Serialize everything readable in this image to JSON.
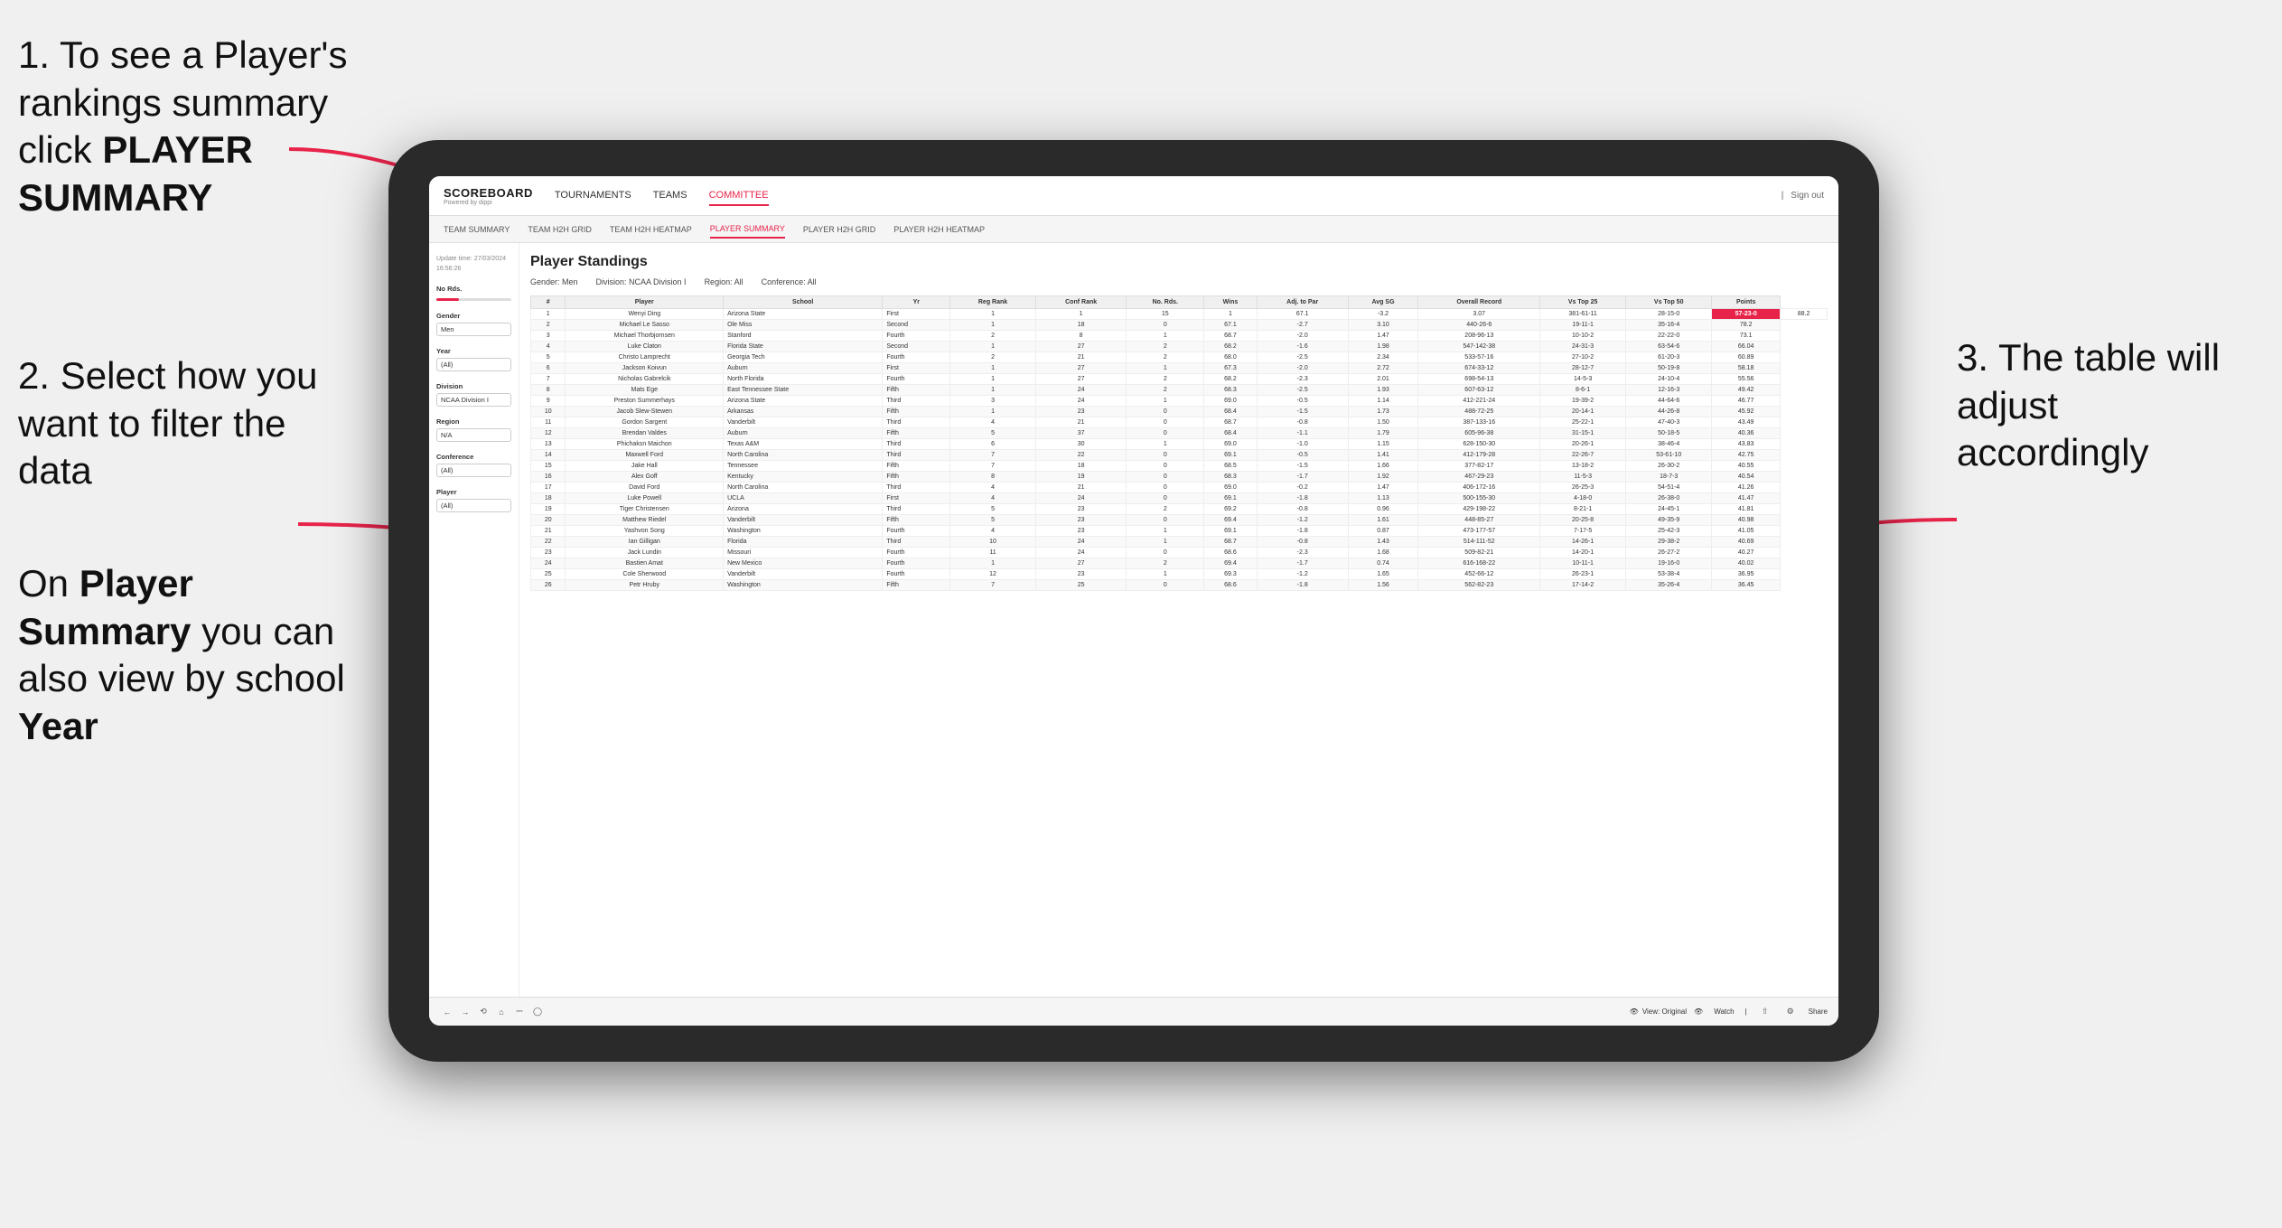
{
  "instructions": {
    "step1": "1. To see a Player's rankings summary click ",
    "step1_bold": "PLAYER SUMMARY",
    "step2_title": "2. Select how you want to filter the data",
    "step3": "3. The table will adjust accordingly",
    "bottom_note_pre": "On ",
    "bottom_bold1": "Player Summary",
    "bottom_note_mid": " you can also view by school ",
    "bottom_bold2": "Year"
  },
  "nav": {
    "logo": "SCOREBOARD",
    "logo_sub": "Powered by dippi",
    "links": [
      "TOURNAMENTS",
      "TEAMS",
      "COMMITTEE"
    ],
    "active_link": "COMMITTEE",
    "sign_out": "Sign out"
  },
  "sub_nav": {
    "links": [
      "TEAM SUMMARY",
      "TEAM H2H GRID",
      "TEAM H2H HEATMAP",
      "PLAYER SUMMARY",
      "PLAYER H2H GRID",
      "PLAYER H2H HEATMAP"
    ],
    "active": "PLAYER SUMMARY"
  },
  "sidebar": {
    "update_label": "Update time:",
    "update_value": "27/03/2024 16:56:26",
    "no_rds_label": "No Rds.",
    "gender_label": "Gender",
    "gender_value": "Men",
    "year_label": "Year",
    "year_value": "(All)",
    "division_label": "Division",
    "division_value": "NCAA Division I",
    "region_label": "Region",
    "region_value": "N/A",
    "conference_label": "Conference",
    "conference_value": "(All)",
    "player_label": "Player",
    "player_value": "(All)"
  },
  "table": {
    "title": "Player Standings",
    "filters": {
      "gender": "Gender: Men",
      "division": "Division: NCAA Division I",
      "region": "Region: All",
      "conference": "Conference: All"
    },
    "columns": [
      "#",
      "Player",
      "School",
      "Yr",
      "Reg Rank",
      "Conf Rank",
      "No. Rds.",
      "Wins",
      "Adj. to Par",
      "Avg SG",
      "Overall Record",
      "Vs Top 25",
      "Vs Top 50",
      "Points"
    ],
    "rows": [
      [
        "1",
        "Wenyi Ding",
        "Arizona State",
        "First",
        "1",
        "1",
        "15",
        "1",
        "67.1",
        "-3.2",
        "3.07",
        "381-61-11",
        "28-15-0",
        "57-23-0",
        "88.2"
      ],
      [
        "2",
        "Michael Le Sasso",
        "Ole Miss",
        "Second",
        "1",
        "18",
        "0",
        "67.1",
        "-2.7",
        "3.10",
        "440-26-6",
        "19-11-1",
        "35-16-4",
        "78.2"
      ],
      [
        "3",
        "Michael Thorbjornsen",
        "Stanford",
        "Fourth",
        "2",
        "8",
        "1",
        "68.7",
        "-2.0",
        "1.47",
        "208-96-13",
        "10-10-2",
        "22-22-0",
        "73.1"
      ],
      [
        "4",
        "Luke Claton",
        "Florida State",
        "Second",
        "1",
        "27",
        "2",
        "68.2",
        "-1.6",
        "1.98",
        "547-142-38",
        "24-31-3",
        "63-54-6",
        "66.04"
      ],
      [
        "5",
        "Christo Lamprecht",
        "Georgia Tech",
        "Fourth",
        "2",
        "21",
        "2",
        "68.0",
        "-2.5",
        "2.34",
        "533-57-16",
        "27-10-2",
        "61-20-3",
        "60.89"
      ],
      [
        "6",
        "Jackson Koivun",
        "Auburn",
        "First",
        "1",
        "27",
        "1",
        "67.3",
        "-2.0",
        "2.72",
        "674-33-12",
        "28-12-7",
        "50-19-8",
        "58.18"
      ],
      [
        "7",
        "Nicholas Gabrelcik",
        "North Florida",
        "Fourth",
        "1",
        "27",
        "2",
        "68.2",
        "-2.3",
        "2.01",
        "698-54-13",
        "14-5-3",
        "24-10-4",
        "55.56"
      ],
      [
        "8",
        "Mats Ege",
        "East Tennessee State",
        "Fifth",
        "1",
        "24",
        "2",
        "68.3",
        "-2.5",
        "1.93",
        "607-63-12",
        "8-6-1",
        "12-16-3",
        "49.42"
      ],
      [
        "9",
        "Preston Summerhays",
        "Arizona State",
        "Third",
        "3",
        "24",
        "1",
        "69.0",
        "-0.5",
        "1.14",
        "412-221-24",
        "19-39-2",
        "44-64-6",
        "46.77"
      ],
      [
        "10",
        "Jacob Slew-Stewen",
        "Arkansas",
        "Fifth",
        "1",
        "23",
        "0",
        "68.4",
        "-1.5",
        "1.73",
        "488-72-25",
        "20-14-1",
        "44-26-8",
        "45.92"
      ],
      [
        "11",
        "Gordon Sargent",
        "Vanderbilt",
        "Third",
        "4",
        "21",
        "0",
        "68.7",
        "-0.8",
        "1.50",
        "387-133-16",
        "25-22-1",
        "47-40-3",
        "43.49"
      ],
      [
        "12",
        "Brendan Valdes",
        "Auburn",
        "Fifth",
        "5",
        "37",
        "0",
        "68.4",
        "-1.1",
        "1.79",
        "605-96-38",
        "31-15-1",
        "50-18-5",
        "40.36"
      ],
      [
        "13",
        "Phichaksn Maichon",
        "Texas A&M",
        "Third",
        "6",
        "30",
        "1",
        "69.0",
        "-1.0",
        "1.15",
        "628-150-30",
        "20-26-1",
        "38-46-4",
        "43.83"
      ],
      [
        "14",
        "Maxwell Ford",
        "North Carolina",
        "Third",
        "7",
        "22",
        "0",
        "69.1",
        "-0.5",
        "1.41",
        "412-179-28",
        "22-26-7",
        "53-61-10",
        "42.75"
      ],
      [
        "15",
        "Jake Hall",
        "Tennessee",
        "Fifth",
        "7",
        "18",
        "0",
        "68.5",
        "-1.5",
        "1.66",
        "377-82-17",
        "13-18-2",
        "26-30-2",
        "40.55"
      ],
      [
        "16",
        "Alex Goff",
        "Kentucky",
        "Fifth",
        "8",
        "19",
        "0",
        "68.3",
        "-1.7",
        "1.92",
        "467-29-23",
        "11-5-3",
        "18-7-3",
        "40.54"
      ],
      [
        "17",
        "David Ford",
        "North Carolina",
        "Third",
        "4",
        "21",
        "0",
        "69.0",
        "-0.2",
        "1.47",
        "406-172-16",
        "26-25-3",
        "54-51-4",
        "41.26"
      ],
      [
        "18",
        "Luke Powell",
        "UCLA",
        "First",
        "4",
        "24",
        "0",
        "69.1",
        "-1.8",
        "1.13",
        "500-155-30",
        "4-18-0",
        "26-38-0",
        "41.47"
      ],
      [
        "19",
        "Tiger Christensen",
        "Arizona",
        "Third",
        "5",
        "23",
        "2",
        "69.2",
        "-0.8",
        "0.96",
        "429-198-22",
        "8-21-1",
        "24-45-1",
        "41.81"
      ],
      [
        "20",
        "Matthew Riedel",
        "Vanderbilt",
        "Fifth",
        "5",
        "23",
        "0",
        "69.4",
        "-1.2",
        "1.61",
        "448-85-27",
        "20-25-8",
        "49-35-9",
        "40.98"
      ],
      [
        "21",
        "Yashvon Song",
        "Washington",
        "Fourth",
        "4",
        "23",
        "1",
        "69.1",
        "-1.8",
        "0.87",
        "473-177-57",
        "7-17-5",
        "25-42-3",
        "41.05"
      ],
      [
        "22",
        "Ian Gilligan",
        "Florida",
        "Third",
        "10",
        "24",
        "1",
        "68.7",
        "-0.8",
        "1.43",
        "514-111-52",
        "14-26-1",
        "29-38-2",
        "40.69"
      ],
      [
        "23",
        "Jack Lundin",
        "Missouri",
        "Fourth",
        "11",
        "24",
        "0",
        "68.6",
        "-2.3",
        "1.68",
        "509-82-21",
        "14-20-1",
        "26-27-2",
        "40.27"
      ],
      [
        "24",
        "Bastien Amat",
        "New Mexico",
        "Fourth",
        "1",
        "27",
        "2",
        "69.4",
        "-1.7",
        "0.74",
        "616-168-22",
        "10-11-1",
        "19-16-0",
        "40.02"
      ],
      [
        "25",
        "Cole Sherwood",
        "Vanderbilt",
        "Fourth",
        "12",
        "23",
        "1",
        "69.3",
        "-1.2",
        "1.65",
        "452-66-12",
        "26-23-1",
        "53-38-4",
        "36.95"
      ],
      [
        "26",
        "Petr Hruby",
        "Washington",
        "Fifth",
        "7",
        "25",
        "0",
        "68.6",
        "-1.8",
        "1.56",
        "562-82-23",
        "17-14-2",
        "35-26-4",
        "36.45"
      ]
    ]
  },
  "toolbar": {
    "view_label": "View: Original",
    "watch_label": "Watch",
    "share_label": "Share"
  }
}
